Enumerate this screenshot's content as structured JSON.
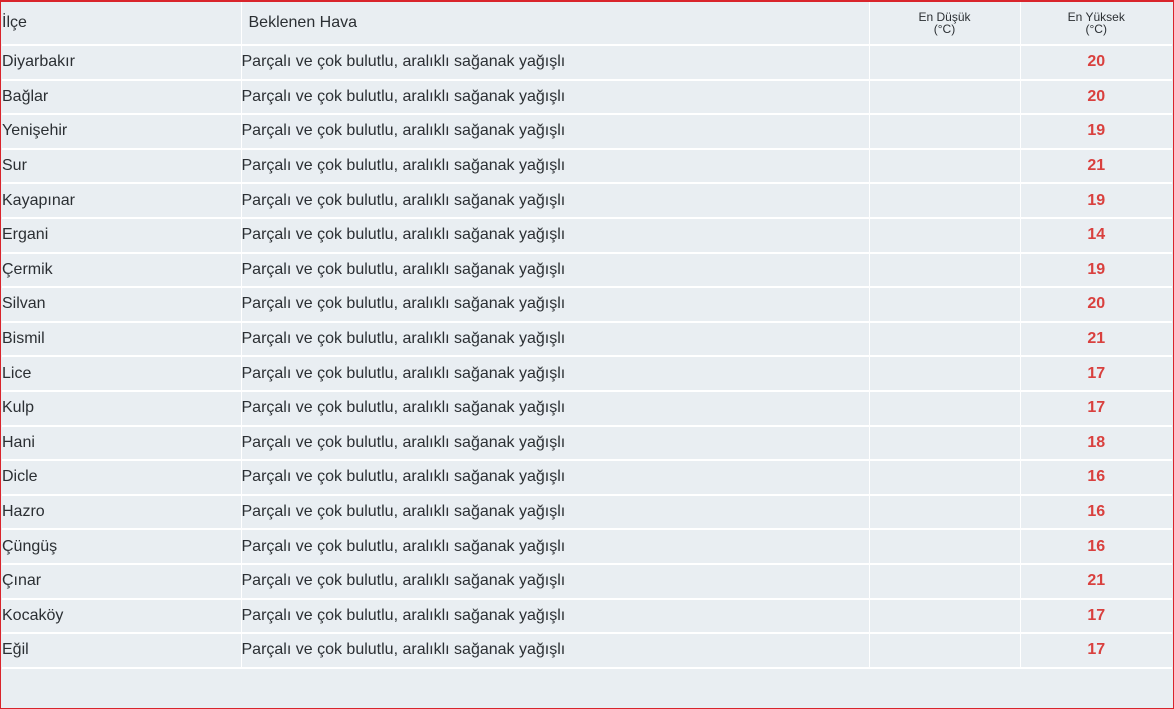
{
  "colors": {
    "accent": "#d9242b",
    "max_temp": "#d9403e",
    "row_bg": "#e9eef2",
    "text": "#2b2f33"
  },
  "header": {
    "district": "İlçe",
    "weather": "Beklenen Hava",
    "min_label": "En Düşük",
    "min_unit": "(°C)",
    "max_label": "En Yüksek",
    "max_unit": "(°C)"
  },
  "rows": [
    {
      "district": "Diyarbakır",
      "weather": "Parçalı ve çok bulutlu, aralıklı sağanak yağışlı",
      "min": "",
      "max": "20"
    },
    {
      "district": "Bağlar",
      "weather": "Parçalı ve çok bulutlu, aralıklı sağanak yağışlı",
      "min": "",
      "max": "20"
    },
    {
      "district": "Yenişehir",
      "weather": "Parçalı ve çok bulutlu, aralıklı sağanak yağışlı",
      "min": "",
      "max": "19"
    },
    {
      "district": "Sur",
      "weather": "Parçalı ve çok bulutlu, aralıklı sağanak yağışlı",
      "min": "",
      "max": "21"
    },
    {
      "district": "Kayapınar",
      "weather": "Parçalı ve çok bulutlu, aralıklı sağanak yağışlı",
      "min": "",
      "max": "19"
    },
    {
      "district": "Ergani",
      "weather": "Parçalı ve çok bulutlu, aralıklı sağanak yağışlı",
      "min": "",
      "max": "14"
    },
    {
      "district": "Çermik",
      "weather": "Parçalı ve çok bulutlu, aralıklı sağanak yağışlı",
      "min": "",
      "max": "19"
    },
    {
      "district": "Silvan",
      "weather": "Parçalı ve çok bulutlu, aralıklı sağanak yağışlı",
      "min": "",
      "max": "20"
    },
    {
      "district": "Bismil",
      "weather": "Parçalı ve çok bulutlu, aralıklı sağanak yağışlı",
      "min": "",
      "max": "21"
    },
    {
      "district": "Lice",
      "weather": "Parçalı ve çok bulutlu, aralıklı sağanak yağışlı",
      "min": "",
      "max": "17"
    },
    {
      "district": "Kulp",
      "weather": "Parçalı ve çok bulutlu, aralıklı sağanak yağışlı",
      "min": "",
      "max": "17"
    },
    {
      "district": "Hani",
      "weather": "Parçalı ve çok bulutlu, aralıklı sağanak yağışlı",
      "min": "",
      "max": "18"
    },
    {
      "district": "Dicle",
      "weather": "Parçalı ve çok bulutlu, aralıklı sağanak yağışlı",
      "min": "",
      "max": "16"
    },
    {
      "district": "Hazro",
      "weather": "Parçalı ve çok bulutlu, aralıklı sağanak yağışlı",
      "min": "",
      "max": "16"
    },
    {
      "district": "Çüngüş",
      "weather": "Parçalı ve çok bulutlu, aralıklı sağanak yağışlı",
      "min": "",
      "max": "16"
    },
    {
      "district": "Çınar",
      "weather": "Parçalı ve çok bulutlu, aralıklı sağanak yağışlı",
      "min": "",
      "max": "21"
    },
    {
      "district": "Kocaköy",
      "weather": "Parçalı ve çok bulutlu, aralıklı sağanak yağışlı",
      "min": "",
      "max": "17"
    },
    {
      "district": "Eğil",
      "weather": "Parçalı ve çok bulutlu, aralıklı sağanak yağışlı",
      "min": "",
      "max": "17"
    }
  ]
}
